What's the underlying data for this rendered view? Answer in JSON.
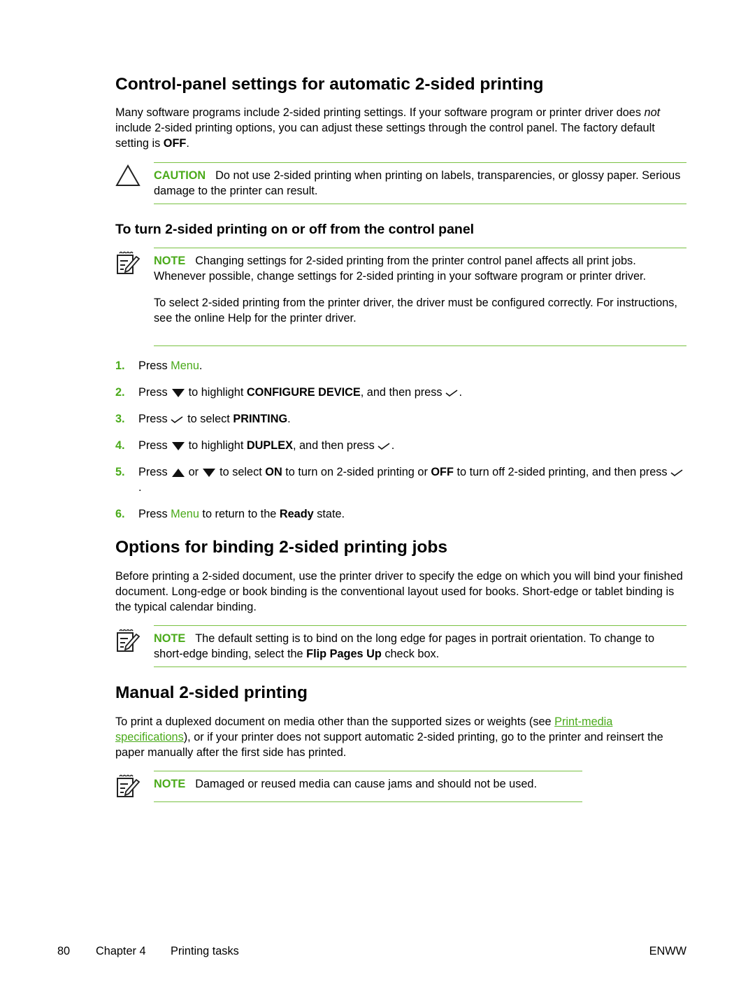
{
  "colors": {
    "accent": "#4aaa1a",
    "rule": "#7ac143",
    "text": "#000000"
  },
  "section1": {
    "title": "Control-panel settings for automatic 2-sided printing",
    "intro": {
      "p1": "Many software programs include 2-sided printing settings. If your software program or printer driver does ",
      "italic": "not",
      "p2": " include 2-sided printing options, you can adjust these settings through the control panel. The factory default setting is ",
      "bold": "OFF",
      "p3": "."
    },
    "caution": {
      "icon": "warning-triangle-icon",
      "label": "CAUTION",
      "text": "Do not use 2-sided printing when printing on labels, transparencies, or glossy paper. Serious damage to the printer can result."
    }
  },
  "subsection": {
    "title": "To turn 2-sided printing on or off from the control panel",
    "note": {
      "icon": "note-pencil-icon",
      "label": "NOTE",
      "text": "Changing settings for 2-sided printing from the printer control panel affects all print jobs. Whenever possible, change settings for 2-sided printing in your software program or printer driver.",
      "text2": "To select 2-sided printing from the printer driver, the driver must be configured correctly. For instructions, see the online Help for the printer driver."
    },
    "steps": [
      {
        "num": "1.",
        "a": "Press ",
        "menu": "Menu",
        "b": "."
      },
      {
        "num": "2.",
        "a": "Press",
        "b": "to highlight ",
        "bold": "CONFIGURE DEVICE",
        "c": ", and then press",
        "d": "."
      },
      {
        "num": "3.",
        "a": "Press",
        "b": "to select ",
        "bold": "PRINTING",
        "c": "."
      },
      {
        "num": "4.",
        "a": "Press",
        "b": "to highlight ",
        "bold": "DUPLEX",
        "c": ", and then press",
        "d": "."
      },
      {
        "num": "5.",
        "a": "Press",
        "or": "or",
        "b": "to select ",
        "bold1": "ON",
        "c": " to turn on 2-sided printing or ",
        "bold2": "OFF",
        "d": " to turn off 2-sided printing, and then press",
        "e": "."
      },
      {
        "num": "6.",
        "a": "Press ",
        "menu": "Menu",
        "b": " to return to the ",
        "bold": "Ready",
        "c": " state."
      }
    ]
  },
  "section2": {
    "title": "Options for binding 2-sided printing jobs",
    "intro": "Before printing a 2-sided document, use the printer driver to specify the edge on which you will bind your finished document. Long-edge or book binding is the conventional layout used for books. Short-edge or tablet binding is the typical calendar binding.",
    "note": {
      "label": "NOTE",
      "a": "The default setting is to bind on the long edge for pages in portrait orientation. To change to short-edge binding, select the ",
      "bold": "Flip Pages Up",
      "b": " check box."
    }
  },
  "section3": {
    "title": "Manual 2-sided printing",
    "intro": {
      "a": "To print a duplexed document on media other than the supported sizes or weights (see ",
      "link": "Print-media specifications",
      "b": "), or if your printer does not support automatic 2-sided printing, go to the printer and reinsert the paper manually after the first side has printed."
    },
    "note": {
      "label": "NOTE",
      "text": "Damaged or reused media can cause jams and should not be used."
    }
  },
  "footer": {
    "page": "80",
    "chapter": "Chapter 4",
    "section": "Printing tasks",
    "right": "ENWW"
  }
}
